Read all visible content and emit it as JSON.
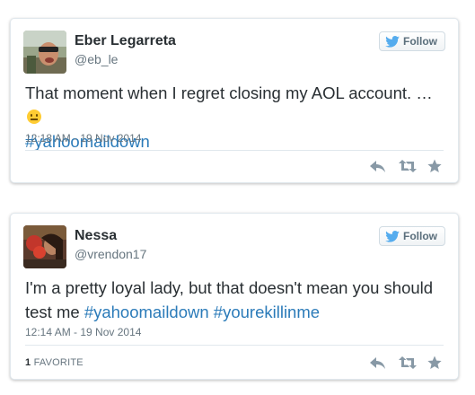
{
  "tweets": [
    {
      "name": "Eber Legarreta",
      "handle": "@eb_le",
      "follow_label": "Follow",
      "text_before": "That moment when I regret closing my AOL account. … ",
      "hashtags": [
        "#yahoomaildown"
      ],
      "timestamp": "12:18 AM - 19 Nov 2014",
      "emoji": "neutral-face-emoji"
    },
    {
      "name": "Nessa",
      "handle": "@vrendon17",
      "follow_label": "Follow",
      "text_before": "I'm a pretty loyal lady, but that doesn't mean you should test me ",
      "hashtags": [
        "#yahoomaildown",
        "#yourekillinme"
      ],
      "timestamp": "12:14 AM - 19 Nov 2014",
      "favorites_count": "1",
      "favorites_label": "FAVORITE"
    }
  ],
  "colors": {
    "link": "#2b7bb9",
    "text": "#292f33",
    "muted": "#66757f",
    "twitter_bird": "#55acee"
  },
  "icons": [
    "twitter-bird-icon",
    "reply-icon",
    "retweet-icon",
    "favorite-icon"
  ]
}
